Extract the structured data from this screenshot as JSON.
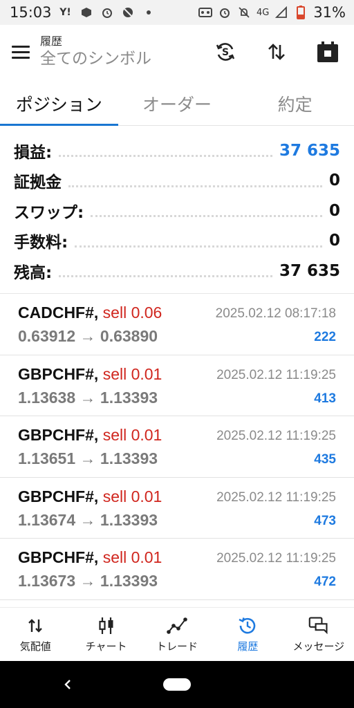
{
  "status_bar": {
    "time": "15:03",
    "left_icons": [
      "yahoo-icon",
      "cube-icon",
      "alarm-icon",
      "block-icon",
      "dot-icon"
    ],
    "network": "4G",
    "battery": "31%",
    "battery_level": 0.31
  },
  "app_bar": {
    "subtitle": "履歴",
    "title": "全てのシンボル",
    "actions": [
      "currency-sync-icon",
      "sort-icon",
      "calendar-icon"
    ]
  },
  "tabs": [
    {
      "label": "ポジション",
      "active": true
    },
    {
      "label": "オーダー",
      "active": false
    },
    {
      "label": "約定",
      "active": false
    }
  ],
  "summary": {
    "profit": {
      "label": "損益:",
      "value": "37 635"
    },
    "deposit": {
      "label": "証拠金",
      "value": "0"
    },
    "swap": {
      "label": "スワップ:",
      "value": "0"
    },
    "commission": {
      "label": "手数料:",
      "value": "0"
    },
    "balance": {
      "label": "残高:",
      "value": "37 635"
    }
  },
  "deals": [
    {
      "symbol": "CADCHF#,",
      "side": "sell 0.06",
      "open": "0.63912",
      "close": "0.63890",
      "arrow": "→",
      "time": "2025.02.12 08:17:18",
      "profit": "222"
    },
    {
      "symbol": "GBPCHF#,",
      "side": "sell 0.01",
      "open": "1.13638",
      "close": "1.13393",
      "arrow": "→",
      "time": "2025.02.12 11:19:25",
      "profit": "413"
    },
    {
      "symbol": "GBPCHF#,",
      "side": "sell 0.01",
      "open": "1.13651",
      "close": "1.13393",
      "arrow": "→",
      "time": "2025.02.12 11:19:25",
      "profit": "435"
    },
    {
      "symbol": "GBPCHF#,",
      "side": "sell 0.01",
      "open": "1.13674",
      "close": "1.13393",
      "arrow": "→",
      "time": "2025.02.12 11:19:25",
      "profit": "473"
    },
    {
      "symbol": "GBPCHF#,",
      "side": "sell 0.01",
      "open": "1.13673",
      "close": "1.13393",
      "arrow": "→",
      "time": "2025.02.12 11:19:25",
      "profit": "472"
    }
  ],
  "bottom_nav": [
    {
      "label": "気配値",
      "icon": "quotes-icon",
      "active": false
    },
    {
      "label": "チャート",
      "icon": "chart-icon",
      "active": false
    },
    {
      "label": "トレード",
      "icon": "trade-icon",
      "active": false
    },
    {
      "label": "履歴",
      "icon": "history-icon",
      "active": true
    },
    {
      "label": "メッセージ",
      "icon": "messages-icon",
      "active": false
    }
  ],
  "colors": {
    "accent": "#1e7ae0",
    "sell": "#d0261e",
    "muted": "#8a8a8a"
  }
}
